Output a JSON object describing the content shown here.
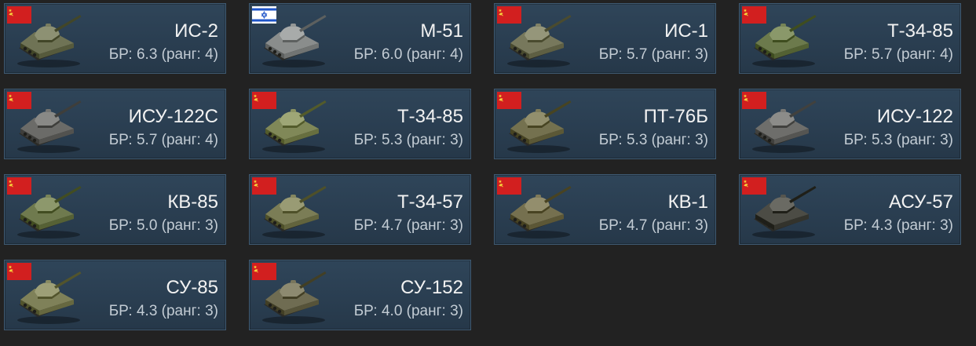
{
  "vehicles": [
    {
      "name": "ИС-2",
      "br": "БР: 6.3 (ранг: 4)",
      "flag": "ussr-flag",
      "tone": "#6f7355"
    },
    {
      "name": "М-51",
      "br": "БР: 6.0 (ранг: 4)",
      "flag": "israel-flag",
      "tone": "#8a8d8c"
    },
    {
      "name": "ИС-1",
      "br": "БР: 5.7 (ранг: 3)",
      "flag": "ussr-flag",
      "tone": "#77785c"
    },
    {
      "name": "Т-34-85",
      "br": "БР: 5.7 (ранг: 4)",
      "flag": "ussr-flag",
      "tone": "#6c7a4c"
    },
    {
      "name": "ИСУ-122С",
      "br": "БР: 5.7 (ранг: 4)",
      "flag": "ussr-flag",
      "tone": "#6b6b68"
    },
    {
      "name": "Т-34-85",
      "br": "БР: 5.3 (ранг: 3)",
      "flag": "ussr-flag",
      "tone": "#808858"
    },
    {
      "name": "ПТ-76Б",
      "br": "БР: 5.3 (ранг: 3)",
      "flag": "ussr-flag",
      "tone": "#74714f"
    },
    {
      "name": "ИСУ-122",
      "br": "БР: 5.3 (ранг: 3)",
      "flag": "ussr-flag",
      "tone": "#6e6e6b"
    },
    {
      "name": "КВ-85",
      "br": "БР: 5.0 (ранг: 3)",
      "flag": "ussr-flag",
      "tone": "#6f7a4e"
    },
    {
      "name": "Т-34-57",
      "br": "БР: 4.7 (ранг: 3)",
      "flag": "ussr-flag",
      "tone": "#7b7d56"
    },
    {
      "name": "КВ-1",
      "br": "БР: 4.7 (ранг: 3)",
      "flag": "ussr-flag",
      "tone": "#75704f"
    },
    {
      "name": "АСУ-57",
      "br": "БР: 4.3 (ранг: 3)",
      "flag": "ussr-flag",
      "tone": "#4c4c45"
    },
    {
      "name": "СУ-85",
      "br": "БР: 4.3 (ранг: 3)",
      "flag": "ussr-flag",
      "tone": "#7f8159"
    },
    {
      "name": "СУ-152",
      "br": "БР: 4.0 (ранг: 3)",
      "flag": "ussr-flag",
      "tone": "#6f6c52"
    }
  ]
}
